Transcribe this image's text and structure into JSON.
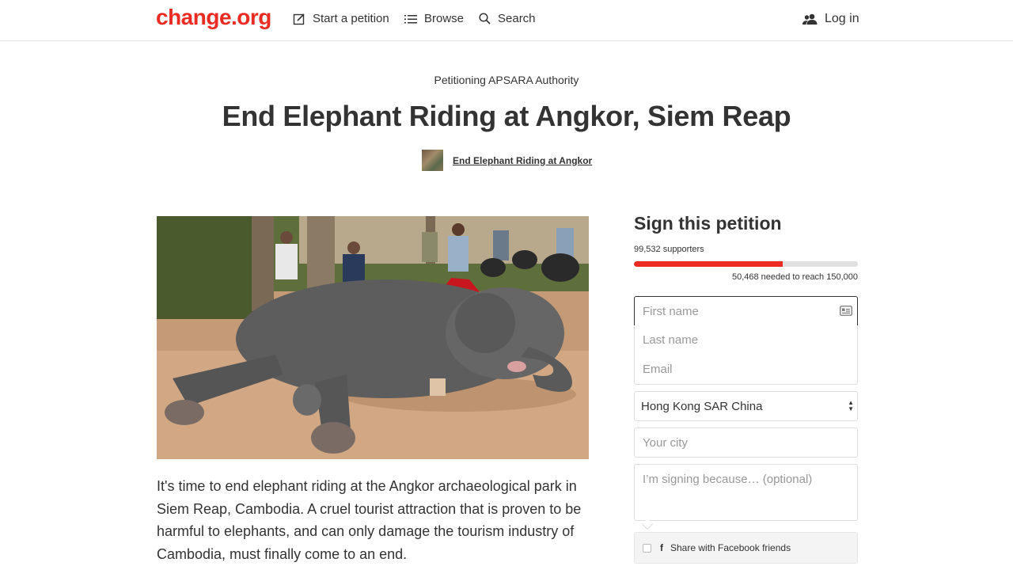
{
  "header": {
    "logo": "change.org",
    "nav": {
      "start": "Start a petition",
      "browse": "Browse",
      "search": "Search",
      "login": "Log in"
    }
  },
  "petition": {
    "petitioning": "Petitioning APSARA Authority",
    "title": "End Elephant Riding at Angkor, Siem Reap",
    "starter_name": "End Elephant Riding at Angkor",
    "description": "It's time to end elephant riding at the Angkor archaeological park in Siem Reap, Cambodia. A cruel tourist attraction that is proven to be harmful to elephants, and can only damage the tourism industry of Cambodia, must finally come to an end."
  },
  "sign_panel": {
    "title": "Sign this petition",
    "supporters_text": "99,532 supporters",
    "needed_text": "50,468 needed to reach 150,000",
    "progress_fraction": 0.6635,
    "first_name_placeholder": "First name",
    "last_name_placeholder": "Last name",
    "email_placeholder": "Email",
    "country_selected": "Hong Kong SAR China",
    "city_placeholder": "Your city",
    "reason_placeholder": "I’m signing because… (optional)",
    "facebook_share_label": "Share with Facebook friends",
    "facebook_icon": "f"
  },
  "colors": {
    "brand_red": "#ec2c22",
    "text": "#333333"
  },
  "icons": {
    "start": "edit-icon",
    "browse": "list-icon",
    "search": "search-icon",
    "login": "users-icon",
    "first_name_field": "id-card-icon"
  }
}
